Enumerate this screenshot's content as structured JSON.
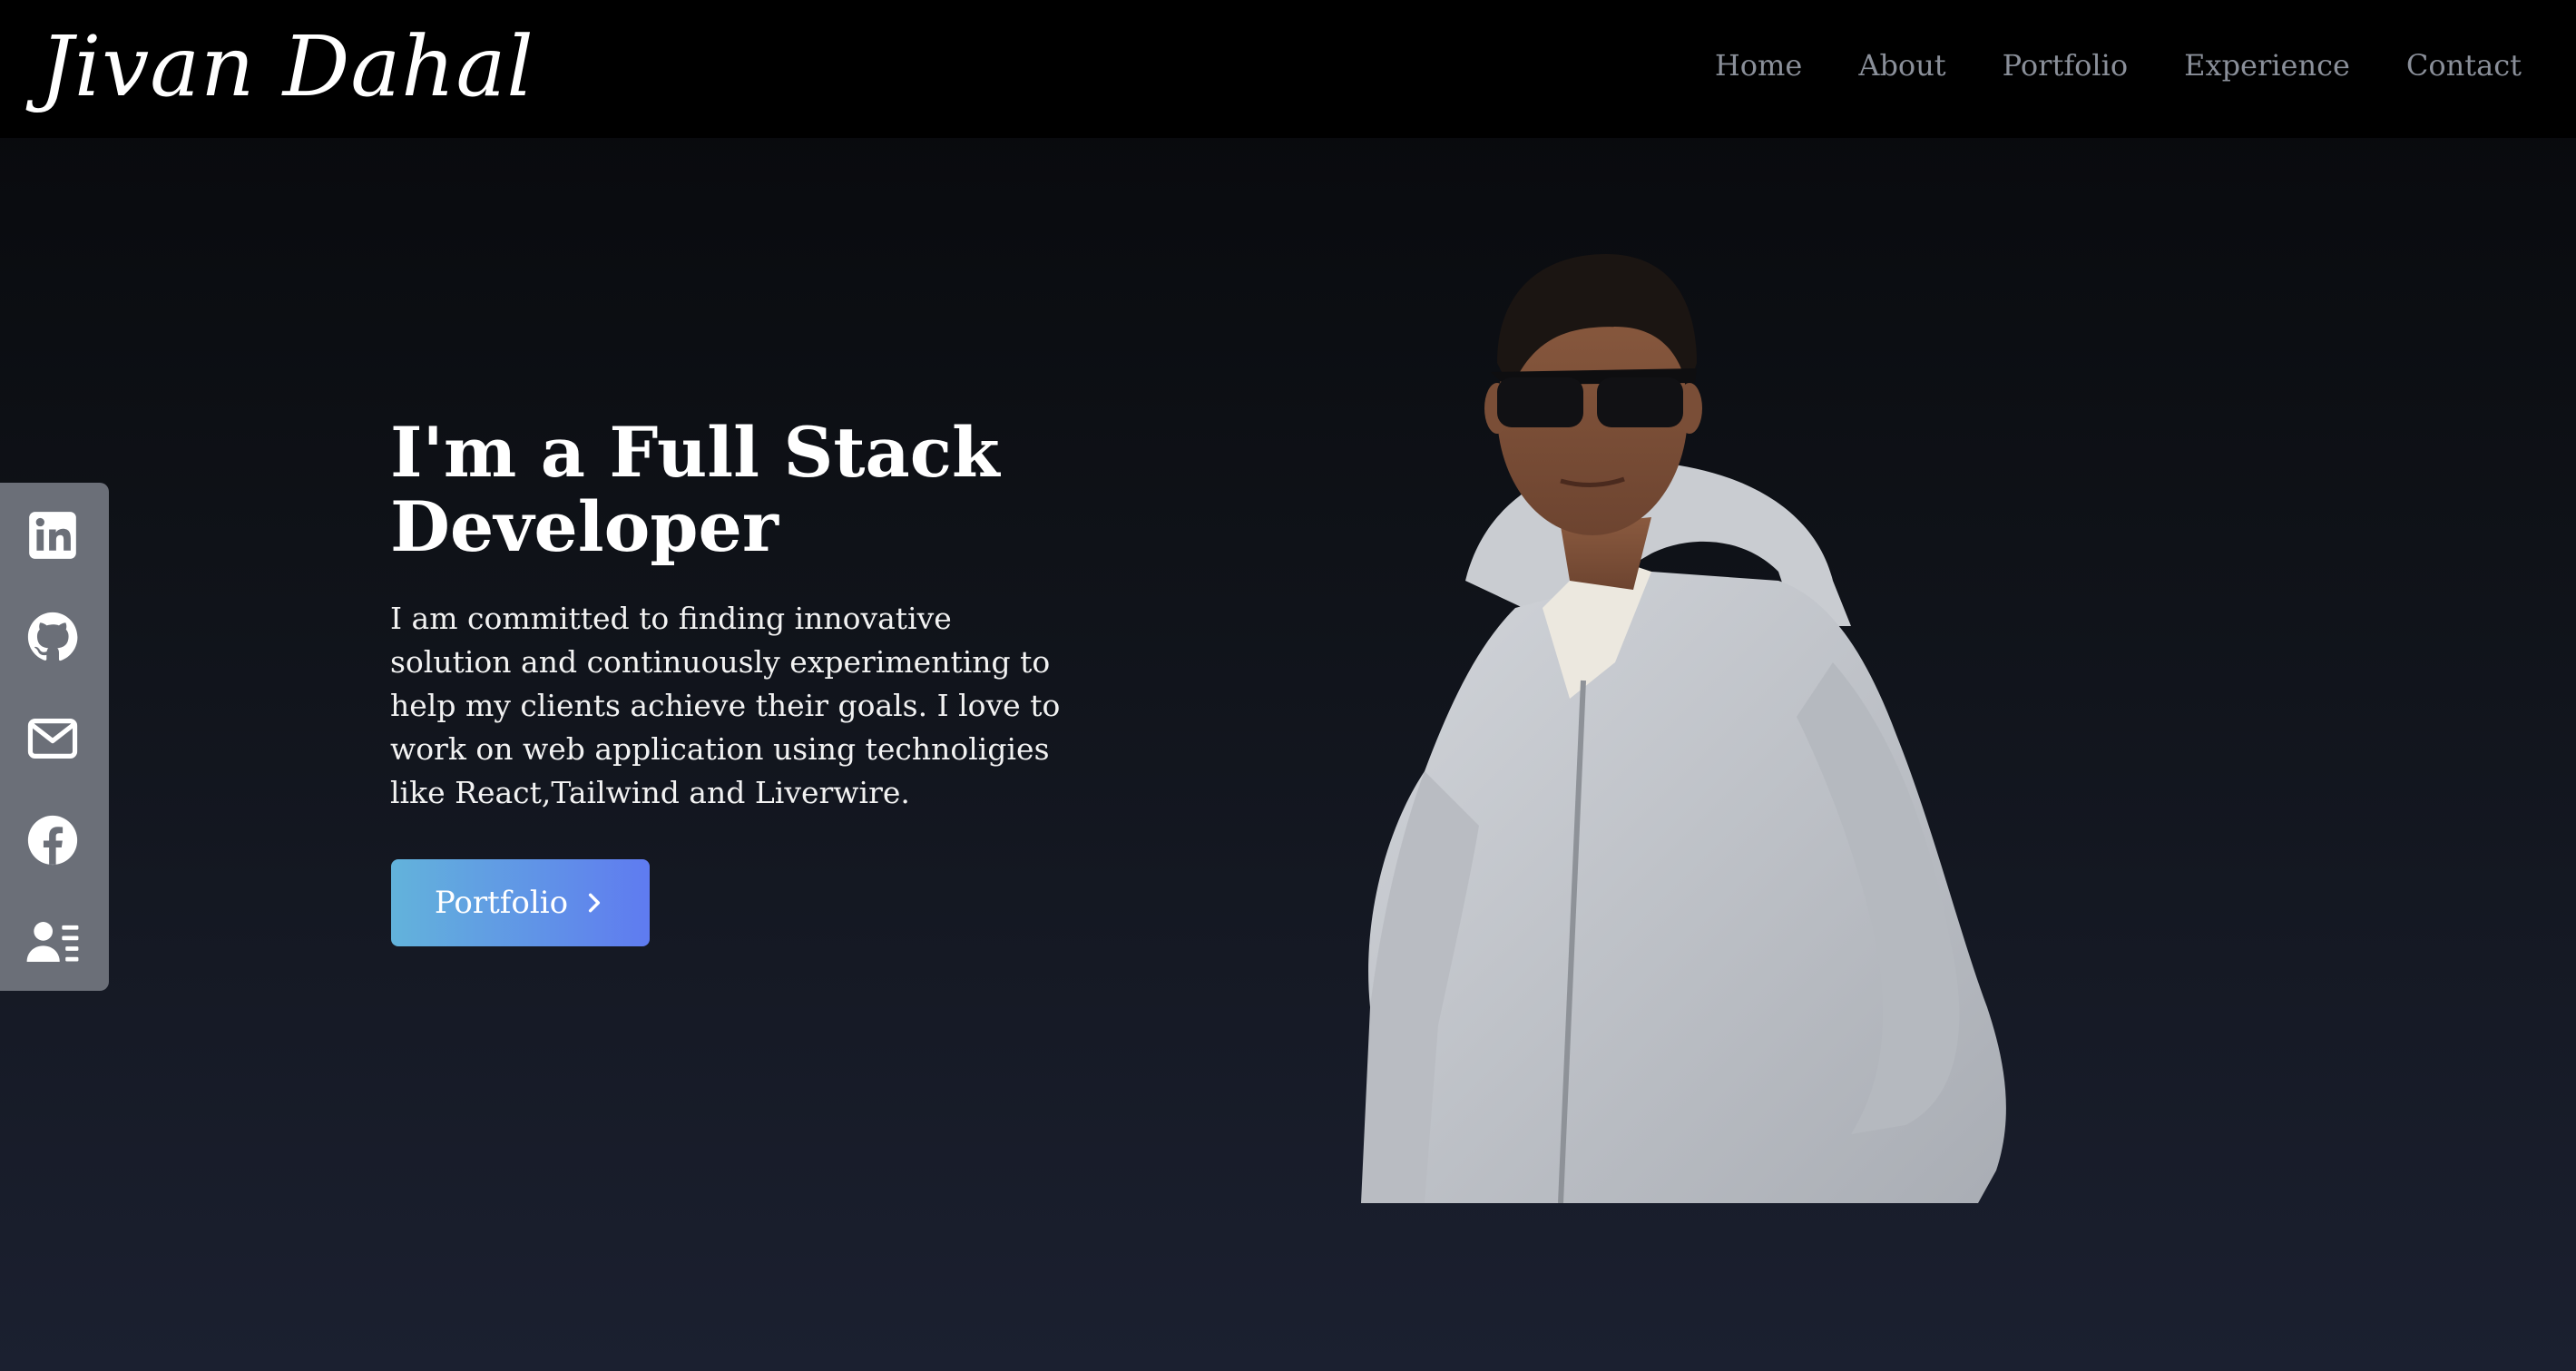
{
  "header": {
    "logo": "Jivan Dahal",
    "nav": [
      "Home",
      "About",
      "Portfolio",
      "Experience",
      "Contact"
    ]
  },
  "sidebar": {
    "icons": [
      "linkedin-icon",
      "github-icon",
      "mail-icon",
      "facebook-icon",
      "resume-icon"
    ]
  },
  "hero": {
    "title": "I'm a Full Stack Developer",
    "description": "I am committed to finding innovative solution and continuously experimenting to help my clients achieve their goals. I love to work on web application using technoligies like React,Tailwind and Liverwire.",
    "button_label": "Portfolio"
  },
  "colors": {
    "nav_bg": "#000000",
    "nav_link": "#8a8f99",
    "sidebar_bg": "#6b6f78",
    "button_gradient_start": "#62b3db",
    "button_gradient_end": "#5f7bf0"
  }
}
